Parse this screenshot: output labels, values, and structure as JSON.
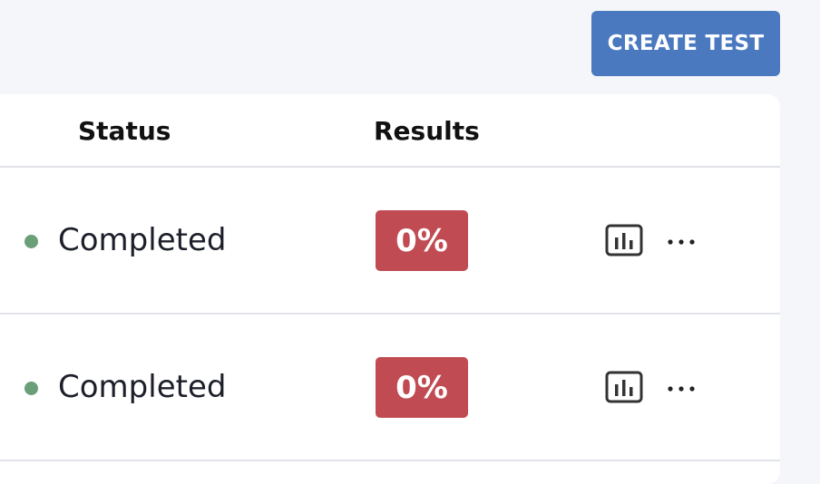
{
  "toolbar": {
    "create_label": "CREATE TEST"
  },
  "table": {
    "columns": [
      "Status",
      "Results"
    ],
    "rows": [
      {
        "status": "Completed",
        "result": "0%",
        "actions": [
          "chart-icon",
          "more-icon"
        ]
      },
      {
        "status": "Completed",
        "result": "0%",
        "actions": [
          "chart-icon",
          "more-icon"
        ]
      }
    ]
  },
  "colors": {
    "primary_button": "#4a79bf",
    "status_completed": "#6a9f78",
    "result_fail": "#c04b52",
    "page_background": "#f5f6fa"
  }
}
